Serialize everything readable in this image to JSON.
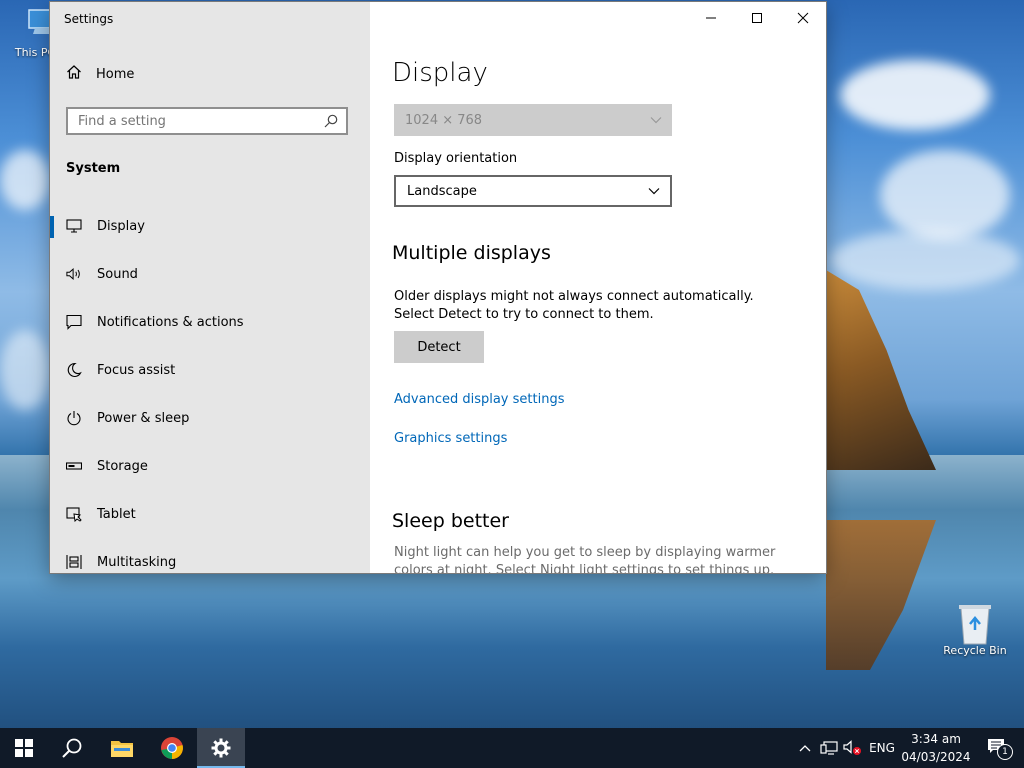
{
  "desktop": {
    "icons": [
      {
        "label": "This PC"
      },
      {
        "label": "Recycle Bin"
      }
    ]
  },
  "window": {
    "title": "Settings",
    "sidebar": {
      "home_label": "Home",
      "search_placeholder": "Find a setting",
      "section": "System",
      "items": [
        {
          "label": "Display",
          "icon": "monitor-icon",
          "active": true
        },
        {
          "label": "Sound",
          "icon": "speaker-icon"
        },
        {
          "label": "Notifications & actions",
          "icon": "notification-icon"
        },
        {
          "label": "Focus assist",
          "icon": "moon-icon"
        },
        {
          "label": "Power & sleep",
          "icon": "power-icon"
        },
        {
          "label": "Storage",
          "icon": "storage-icon"
        },
        {
          "label": "Tablet",
          "icon": "tablet-icon"
        },
        {
          "label": "Multitasking",
          "icon": "multitasking-icon"
        }
      ]
    },
    "content": {
      "page_title": "Display",
      "resolution_value": "1024 × 768",
      "orientation_label": "Display orientation",
      "orientation_value": "Landscape",
      "multiple_displays_heading": "Multiple displays",
      "multiple_displays_text": "Older displays might not always connect automatically. Select Detect to try to connect to them.",
      "detect_label": "Detect",
      "advanced_link": "Advanced display settings",
      "graphics_link": "Graphics settings",
      "sleep_heading": "Sleep better",
      "sleep_text": "Night light can help you get to sleep by displaying warmer colors at night. Select Night light settings to set things up."
    }
  },
  "taskbar": {
    "language": "ENG",
    "time": "3:34 am",
    "date": "04/03/2024",
    "notification_count": "1"
  },
  "colors": {
    "accent": "#0063b1",
    "link": "#0067b8",
    "sidebar_bg": "#e6e6e6",
    "taskbar_bg": "#101a28"
  }
}
